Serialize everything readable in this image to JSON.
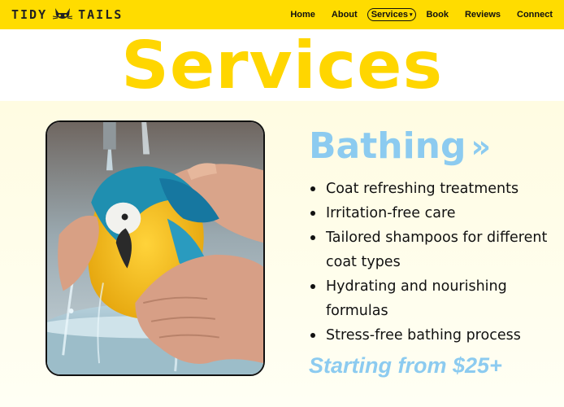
{
  "brand": {
    "left": "TIDY",
    "right": "TAILS",
    "logo_icon": "cat-face-icon"
  },
  "nav": {
    "items": [
      {
        "label": "Home"
      },
      {
        "label": "About"
      },
      {
        "label": "Services",
        "active": true,
        "caret": "▾"
      },
      {
        "label": "Book"
      },
      {
        "label": "Reviews"
      },
      {
        "label": "Connect"
      }
    ]
  },
  "page": {
    "title": "Services"
  },
  "service": {
    "name": "Bathing",
    "arrows": "»",
    "features": [
      "Coat refreshing treatments",
      "Irritation-free care",
      "Tailored shampoos for different coat types",
      "Hydrating and nourishing formulas",
      "Stress-free bathing process"
    ],
    "price": "Starting from $25+",
    "image_subject": "macaw-being-bathed-photo"
  },
  "colors": {
    "header_bg": "#ffdc00",
    "title": "#ffd600",
    "accent_blue": "#8ccbf0",
    "text": "#111111"
  }
}
